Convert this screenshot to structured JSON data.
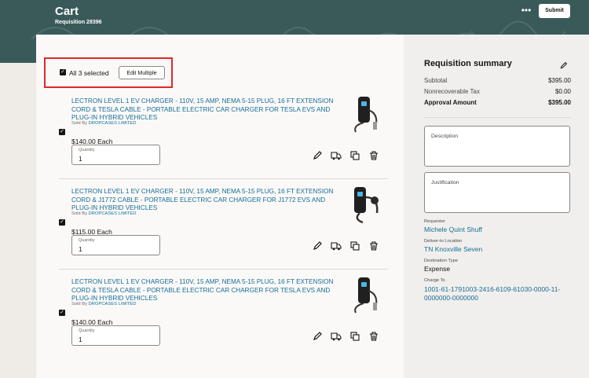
{
  "header": {
    "title": "Cart",
    "subtitle": "Requisition 28396",
    "more_icon": "more-dots-icon",
    "submit_label": "Submit"
  },
  "selection": {
    "summary_text": "All 3 selected",
    "edit_multiple_label": "Edit Multiple"
  },
  "items": [
    {
      "title": "LECTRON LEVEL 1 EV CHARGER - 110V, 15 AMP, NEMA 5-15 PLUG, 16 FT EXTENSION CORD & TESLA CABLE - PORTABLE ELECTRIC CAR CHARGER FOR TESLA EVS AND PLUG-IN HYBRID VEHICLES",
      "sold_by_label": "Sold By",
      "seller": "DROPCASES LIMITED",
      "price": "$140.00 Each",
      "quantity_label": "Quantity",
      "quantity": "1",
      "checked": true
    },
    {
      "title": "LECTRON LEVEL 1 EV CHARGER - 110V, 15 AMP, NEMA 5-15 PLUG, 16 FT EXTENSION CORD & J1772 CABLE - PORTABLE ELECTRIC CAR CHARGER FOR J1772 EVS AND PLUG-IN HYBRID VEHICLES",
      "sold_by_label": "Sold By",
      "seller": "DROPCASES LIMITED",
      "price": "$115.00 Each",
      "quantity_label": "Quantity",
      "quantity": "1",
      "checked": true
    },
    {
      "title": "LECTRON LEVEL 1 EV CHARGER - 110V, 15 AMP, NEMA 5-15 PLUG, 16 FT EXTENSION CORD & TESLA CABLE - PORTABLE ELECTRIC CAR CHARGER FOR TESLA EVS AND PLUG-IN HYBRID VEHICLES",
      "sold_by_label": "Sold By",
      "seller": "DROPCASES LIMITED",
      "price": "$140.00 Each",
      "quantity_label": "Quantity",
      "quantity": "1",
      "checked": true
    }
  ],
  "item_actions": [
    "edit-pencil-icon",
    "delivery-truck-icon",
    "duplicate-icon",
    "delete-trash-icon"
  ],
  "summary": {
    "title": "Requisition summary",
    "subtotal_label": "Subtotal",
    "subtotal": "$395.00",
    "tax_label": "Nonrecoverable Tax",
    "tax": "$0.00",
    "approval_label": "Approval Amount",
    "approval": "$395.00",
    "description_placeholder": "Description",
    "justification_placeholder": "Justification",
    "requester_label": "Requester",
    "requester": "Michele Quint Shuff",
    "deliver_label": "Deliver-to Location",
    "deliver": "TN Knoxville Seven",
    "destination_label": "Destination Type",
    "destination": "Expense",
    "charge_label": "Charge To",
    "charge": "1001-61-1791003-2416-6109-61030-0000-11-0000000-0000000"
  },
  "colors": {
    "banner": "#3a5a5a",
    "link": "#176d96",
    "highlight": "#e0282a"
  }
}
